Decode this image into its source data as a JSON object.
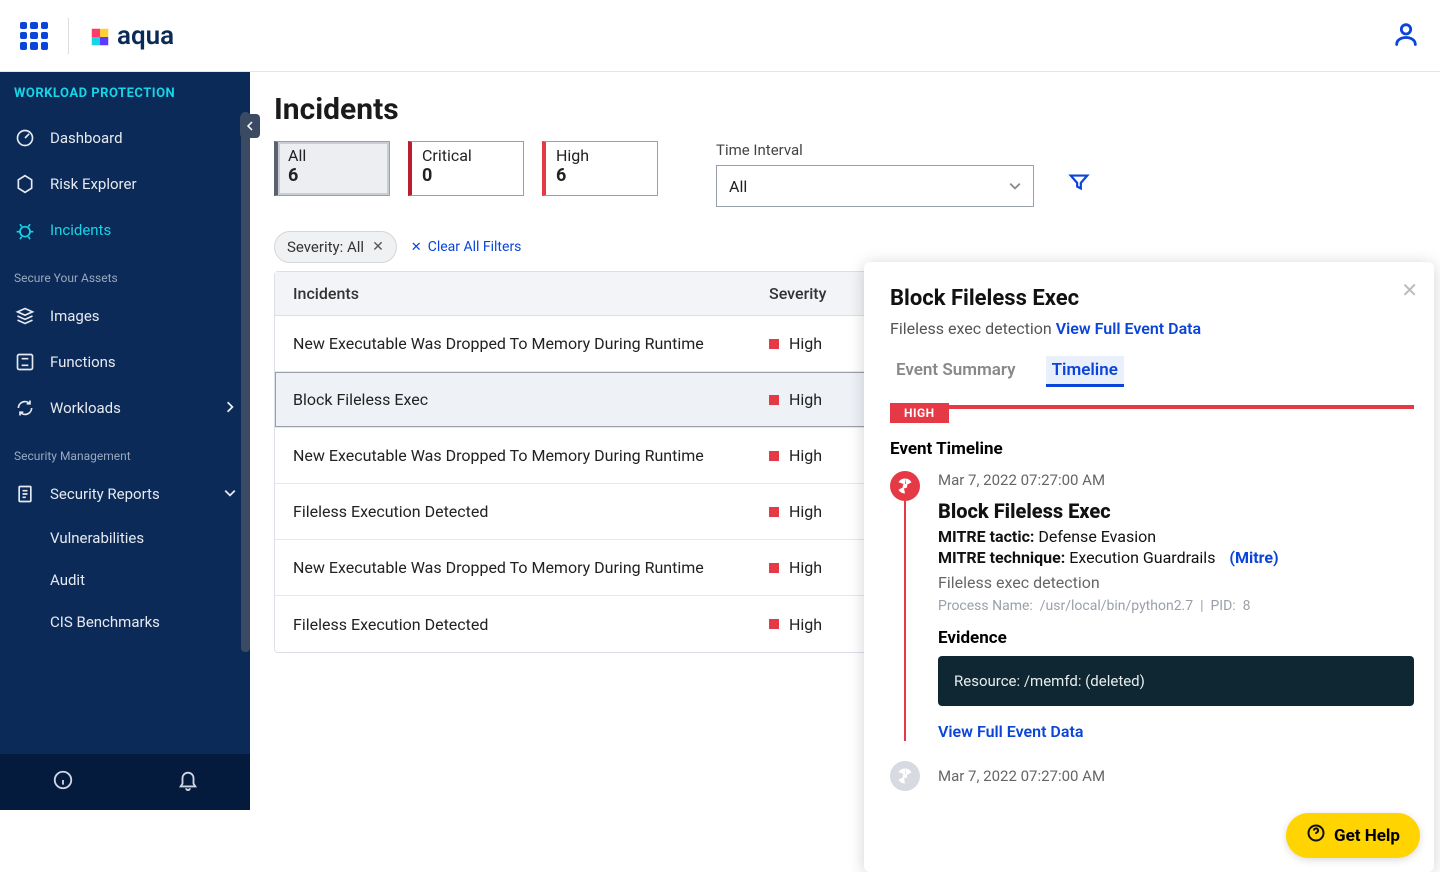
{
  "brand": "aqua",
  "sidebar": {
    "section_title": "WORKLOAD PROTECTION",
    "items": [
      {
        "label": "Dashboard",
        "icon": "gauge"
      },
      {
        "label": "Risk Explorer",
        "icon": "hex"
      },
      {
        "label": "Incidents",
        "icon": "bug",
        "active": true
      }
    ],
    "group1_label": "Secure Your Assets",
    "group1": [
      {
        "label": "Images",
        "icon": "stack"
      },
      {
        "label": "Functions",
        "icon": "fn"
      },
      {
        "label": "Workloads",
        "icon": "loop",
        "expandable": true
      }
    ],
    "group2_label": "Security Management",
    "group2": [
      {
        "label": "Security Reports",
        "icon": "doc",
        "expandable": true,
        "expanded": true
      }
    ],
    "group2_children": [
      {
        "label": "Vulnerabilities"
      },
      {
        "label": "Audit"
      },
      {
        "label": "CIS Benchmarks"
      }
    ]
  },
  "page": {
    "title": "Incidents",
    "severity_cards": [
      {
        "label": "All",
        "count": "6",
        "color": "#5a6270",
        "selected": true
      },
      {
        "label": "Critical",
        "count": "0",
        "color": "#b81e2e"
      },
      {
        "label": "High",
        "count": "6",
        "color": "#e63946"
      }
    ],
    "time_interval_label": "Time Interval",
    "time_interval_value": "All",
    "filter_chip": "Severity: All",
    "clear_filters": "Clear All Filters",
    "columns": {
      "c1": "Incidents",
      "c2": "Severity"
    },
    "rows": [
      {
        "name": "New Executable Was Dropped To Memory During Runtime",
        "sev": "High"
      },
      {
        "name": "Block Fileless Exec",
        "sev": "High",
        "selected": true
      },
      {
        "name": "New Executable Was Dropped To Memory During Runtime",
        "sev": "High"
      },
      {
        "name": "Fileless Execution Detected",
        "sev": "High"
      },
      {
        "name": "New Executable Was Dropped To Memory During Runtime",
        "sev": "High"
      },
      {
        "name": "Fileless Execution Detected",
        "sev": "High"
      }
    ]
  },
  "panel": {
    "title": "Block Fileless Exec",
    "subtitle": "Fileless exec detection",
    "view_full": "View Full Event Data",
    "tabs": {
      "summary": "Event Summary",
      "timeline": "Timeline"
    },
    "sev_badge": "HIGH",
    "et_title": "Event Timeline",
    "event": {
      "ts": "Mar 7, 2022 07:27:00 AM",
      "title": "Block Fileless Exec",
      "tactic_label": "MITRE tactic:",
      "tactic_value": "Defense Evasion",
      "technique_label": "MITRE technique:",
      "technique_value": "Execution Guardrails",
      "mitre_link": "(Mitre)",
      "desc": "Fileless exec detection",
      "process_label": "Process Name:",
      "process_value": "/usr/local/bin/python2.7",
      "pid_label": "PID:",
      "pid_value": "8",
      "evidence_title": "Evidence",
      "evidence_body": "Resource: /memfd: (deleted)",
      "view_link": "View Full Event Data"
    },
    "event2_ts": "Mar 7, 2022 07:27:00 AM"
  },
  "get_help": "Get Help"
}
